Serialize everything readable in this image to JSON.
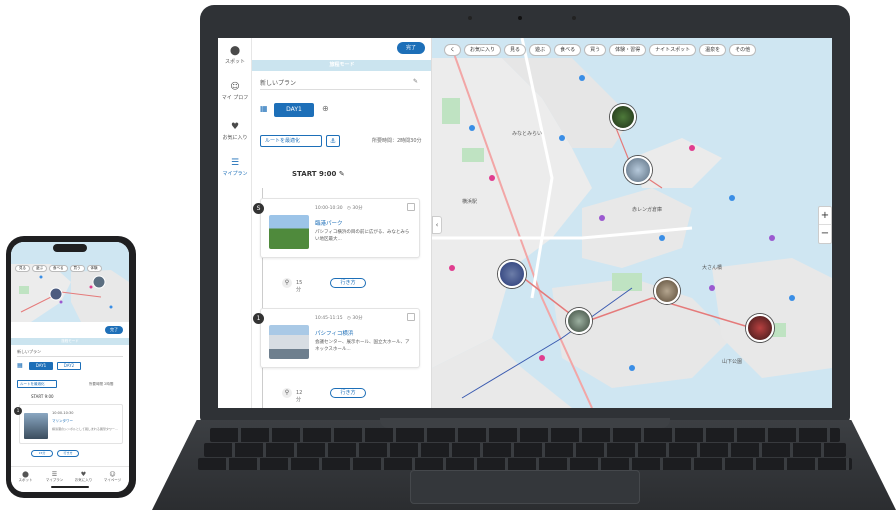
{
  "laptop": {
    "rail": [
      {
        "label": "スポット",
        "icon": "pin-icon"
      },
      {
        "label": "マイ\nプロフ",
        "icon": "user-icon"
      },
      {
        "label": "お気に入り",
        "icon": "heart-icon"
      },
      {
        "label": "マイプラン",
        "icon": "list-icon"
      }
    ],
    "panel": {
      "done_label": "完了",
      "header": "旅程モード",
      "plan_name": "新しいプラン",
      "day_tab": "DAY1",
      "route_button": "ルートを最適化",
      "total_time": "所要時間：2時間30分",
      "start_time": "START 9:00",
      "spots": [
        {
          "num": "S",
          "meta": "10:00-10:30　◷ 30分",
          "name": "臨港パーク",
          "desc": "パシフィコ横浜の目の前に広がる、みなとみらい地区最大..."
        },
        {
          "num": "1",
          "meta": "10:45-11:15　◷ 30分",
          "name": "パシフィコ横浜",
          "desc": "会議センター、展示ホール、国立大ホール、アネックスホール..."
        }
      ],
      "moves": [
        {
          "time": "15分",
          "button": "行き方"
        },
        {
          "time": "12分",
          "button": "行き方"
        }
      ]
    },
    "map": {
      "chips": [
        "く",
        "お気に入り",
        "見る",
        "遊ぶ",
        "食べる",
        "買う",
        "体験・習得",
        "ナイトスポット",
        "温泉を",
        "その他"
      ],
      "labels": [
        "みなとみらい",
        "赤レンガ倉庫",
        "大さん橋",
        "山下公園",
        "横浜駅"
      ],
      "zoom_in": "+",
      "zoom_out": "−",
      "collapse": "‹"
    }
  },
  "phone": {
    "chips": [
      "見る",
      "遊ぶ",
      "食べる",
      "買う",
      "体験"
    ],
    "done_label": "完了",
    "header": "旅程モード",
    "plan_name": "新しいプラン",
    "day1": "DAY1",
    "day2": "DAY2",
    "route_button": "ルートを最適化",
    "total_time": "所要時間 2時間",
    "start_time": "START 9:00",
    "spot": {
      "num": "1",
      "name": "10:00-10:30",
      "link": "マリンタワー",
      "desc": "横浜港のシンボルとして親しまれる展望タワー..."
    },
    "move_buttons": [
      "15分",
      "行き方"
    ],
    "tabs": [
      {
        "label": "スポット",
        "icon": "pin-icon"
      },
      {
        "label": "マイプラン",
        "icon": "list-icon"
      },
      {
        "label": "お気に入り",
        "icon": "heart-icon"
      },
      {
        "label": "マイページ",
        "icon": "user-icon"
      }
    ]
  }
}
